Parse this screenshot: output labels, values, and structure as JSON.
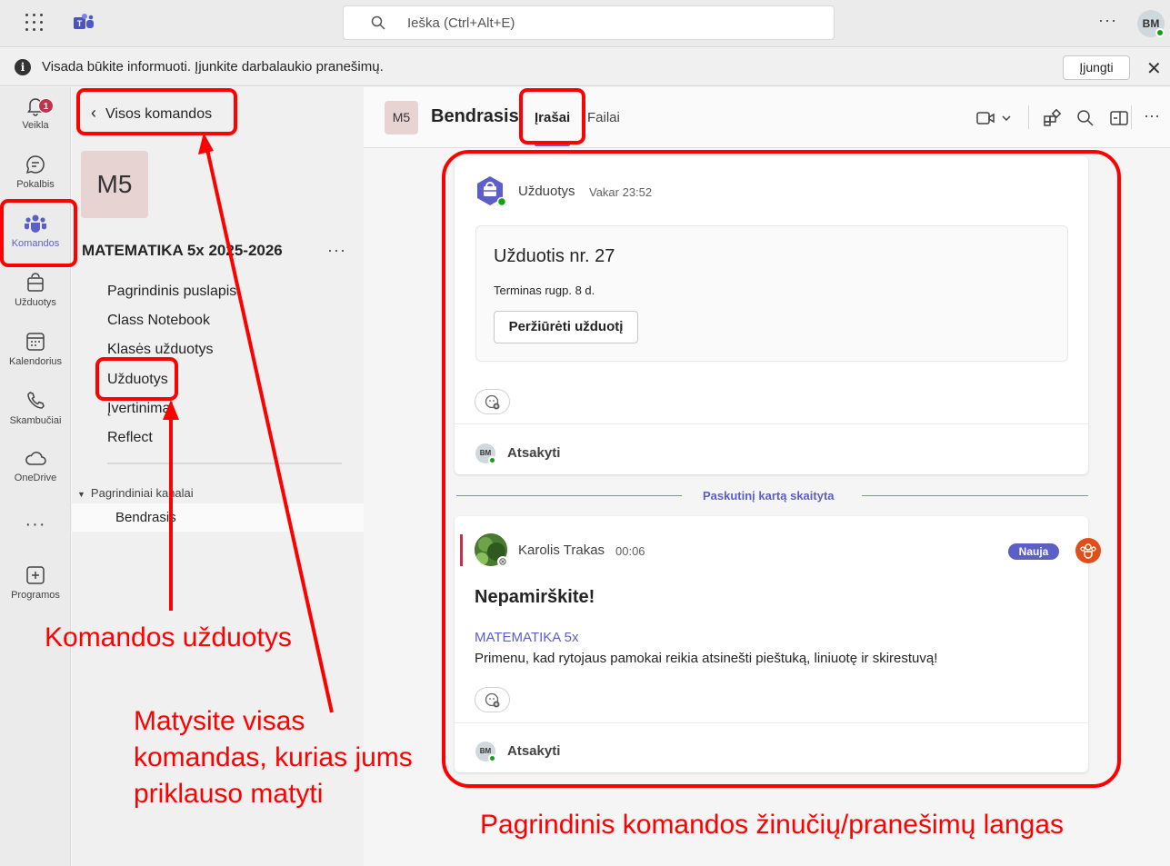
{
  "topbar": {
    "search_placeholder": "Ieška (Ctrl+Alt+E)",
    "more": "···",
    "user_initials": "BM"
  },
  "banner": {
    "info_glyph": "i",
    "text": "Visada būkite informuoti. Įjunkite darbalaukio pranešimų.",
    "enable_label": "Įjungti",
    "close_glyph": "✕"
  },
  "rail": {
    "items": [
      {
        "label": "Veikla",
        "icon": "bell-icon",
        "badge": "1"
      },
      {
        "label": "Pokalbis",
        "icon": "chat-icon"
      },
      {
        "label": "Komandos",
        "icon": "teams-icon",
        "active": true
      },
      {
        "label": "Užduotys",
        "icon": "assignments-icon"
      },
      {
        "label": "Kalendorius",
        "icon": "calendar-icon"
      },
      {
        "label": "Skambučiai",
        "icon": "phone-icon"
      },
      {
        "label": "OneDrive",
        "icon": "cloud-icon"
      }
    ],
    "more": "···",
    "apps_label": "Programos"
  },
  "panel": {
    "back_label": "Visos komandos",
    "team_tile": "M5",
    "team_name": "MATEMATIKA 5x 2025-2026",
    "team_more": "···",
    "nav": [
      "Pagrindinis puslapis",
      "Class Notebook",
      "Klasės užduotys",
      "Užduotys",
      "Įvertinimai",
      "Reflect"
    ],
    "channels_heading": "Pagrindiniai kanalai",
    "channel": "Bendrasis"
  },
  "channel": {
    "tile": "M5",
    "title": "Bendrasis",
    "tabs": [
      "Įrašai",
      "Failai"
    ],
    "more": "···"
  },
  "messages": {
    "assignment": {
      "author": "Užduotys",
      "time": "Vakar 23:52",
      "card_title": "Užduotis nr. 27",
      "due": "Terminas rugp. 8 d.",
      "button": "Peržiūrėti užduotį",
      "reply_initials": "BM",
      "reply": "Atsakyti"
    },
    "last_read": "Paskutinį kartą skaityta",
    "post": {
      "author": "Karolis Trakas",
      "time": "00:06",
      "new_label": "Nauja",
      "title": "Nepamirškite!",
      "team_tag": "MATEMATIKA 5x",
      "body": "Primenu, kad rytojaus pamokai reikia atsinešti pieštuką, liniuotę ir skirestuvą!",
      "reply_initials": "BM",
      "reply": "Atsakyti"
    }
  },
  "annotations": {
    "team_assignments": "Komandos užduotys",
    "all_teams": [
      "Matysite visas",
      "komandas, kurias jums",
      "priklauso matyti"
    ],
    "main_window": "Pagrindinis komandos žinučių/pranešimų langas",
    "color": "#ff0000"
  },
  "colors": {
    "accent": "#5b5fc7",
    "alert": "#c4314b",
    "presence": "#13a10e"
  }
}
